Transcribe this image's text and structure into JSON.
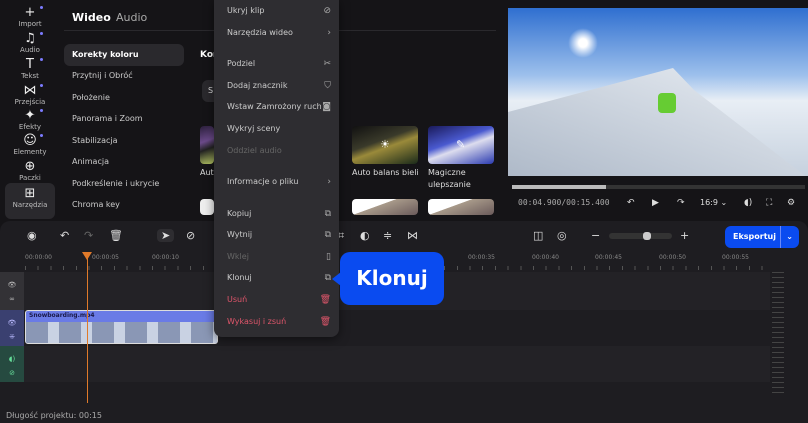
{
  "sidebar": {
    "items": [
      {
        "label": "Import",
        "icon": "+"
      },
      {
        "label": "Audio",
        "icon": "♫"
      },
      {
        "label": "Tekst",
        "icon": "T"
      },
      {
        "label": "Przejścia",
        "icon": "⋈"
      },
      {
        "label": "Efekty",
        "icon": "✦"
      },
      {
        "label": "Elementy",
        "icon": "☺"
      },
      {
        "label": "Paczki",
        "icon": "⊕"
      },
      {
        "label": "Narzędzia",
        "icon": "⊞"
      }
    ]
  },
  "panel": {
    "tabs": [
      "Wideo",
      "Audio"
    ],
    "categories": [
      "Korekty koloru",
      "Przytnij i Obróć",
      "Położenie",
      "Panorama i Zoom",
      "Stabilizacja",
      "Animacja",
      "Podkreślenie i ukrycie",
      "Chroma key"
    ],
    "section_title": "Korekty koloru",
    "search_stub": "S",
    "presets": [
      "Auto",
      "Auto balans bieli",
      "Magiczne ulepszanie"
    ]
  },
  "context_menu": {
    "items": [
      {
        "label": "Ukryj klip",
        "icon": "eye-off"
      },
      {
        "label": "Narzędzia wideo",
        "icon": "›"
      },
      {
        "label": "Podziel",
        "icon": "✂"
      },
      {
        "label": "Dodaj znacznik",
        "icon": "⛉"
      },
      {
        "label": "Wstaw Zamrożony ruch",
        "icon": "◙"
      },
      {
        "label": "Wykryj sceny",
        "icon": ""
      },
      {
        "label": "Oddziel audio",
        "icon": ""
      },
      {
        "label": "Informacje o pliku",
        "icon": "›"
      },
      {
        "label": "Kopiuj",
        "icon": "⧉"
      },
      {
        "label": "Wytnij",
        "icon": "⧉"
      },
      {
        "label": "Wklej",
        "icon": "▯"
      },
      {
        "label": "Klonuj",
        "icon": "⧉"
      },
      {
        "label": "Usuń",
        "icon": "🗑"
      },
      {
        "label": "Wykasuj i zsuń",
        "icon": "🗑"
      }
    ]
  },
  "callout": "Klonuj",
  "player": {
    "time": "00:04.900/00:15.400",
    "aspect": "16:9",
    "progress": 0.32
  },
  "export_label": "Eksportuj",
  "ruler": [
    "00:00:00",
    "00:00:05",
    "00:00:10",
    "00:00:35",
    "00:00:40",
    "00:00:45",
    "00:00:50",
    "00:00:55"
  ],
  "clip_name": "Snowboarding.mp4",
  "footer": "Długość projektu: 00:15",
  "colors": {
    "accent": "#0a4bf0",
    "playhead": "#e07a2a",
    "danger": "#e0566b"
  }
}
